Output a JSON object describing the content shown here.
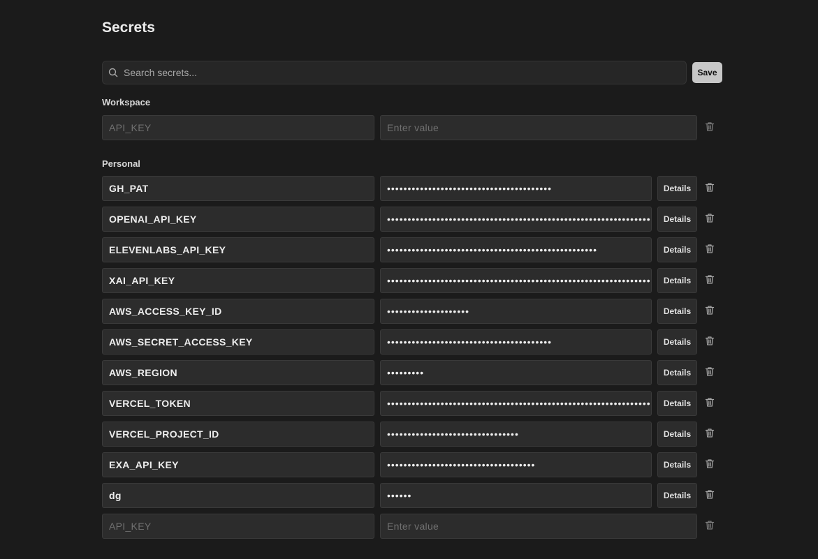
{
  "page": {
    "title": "Secrets"
  },
  "search": {
    "placeholder": "Search secrets..."
  },
  "toolbar": {
    "save_label": "Save"
  },
  "workspace": {
    "label": "Workspace",
    "new_row": {
      "key_placeholder": "API_KEY",
      "value_placeholder": "Enter value"
    }
  },
  "personal": {
    "label": "Personal",
    "details_label": "Details",
    "items": [
      {
        "key": "GH_PAT",
        "masked": "••••••••••••••••••••••••••••••••••••••••"
      },
      {
        "key": "OPENAI_API_KEY",
        "masked": "•••••••••••••••••••••••••••••••••••••••••••••••••••••••••••••••••••••"
      },
      {
        "key": "ELEVENLABS_API_KEY",
        "masked": "•••••••••••••••••••••••••••••••••••••••••••••••••••"
      },
      {
        "key": "XAI_API_KEY",
        "masked": "•••••••••••••••••••••••••••••••••••••••••••••••••••••••••••••••••••••"
      },
      {
        "key": "AWS_ACCESS_KEY_ID",
        "masked": "••••••••••••••••••••"
      },
      {
        "key": "AWS_SECRET_ACCESS_KEY",
        "masked": "••••••••••••••••••••••••••••••••••••••••"
      },
      {
        "key": "AWS_REGION",
        "masked": "•••••••••"
      },
      {
        "key": "VERCEL_TOKEN",
        "masked": "•••••••••••••••••••••••••••••••••••••••••••••••••••••••••••••••••••••"
      },
      {
        "key": "VERCEL_PROJECT_ID",
        "masked": "••••••••••••••••••••••••••••••••"
      },
      {
        "key": "EXA_API_KEY",
        "masked": "••••••••••••••••••••••••••••••••••••"
      },
      {
        "key": "dg",
        "masked": "••••••"
      }
    ],
    "new_row": {
      "key_placeholder": "API_KEY",
      "value_placeholder": "Enter value"
    }
  }
}
